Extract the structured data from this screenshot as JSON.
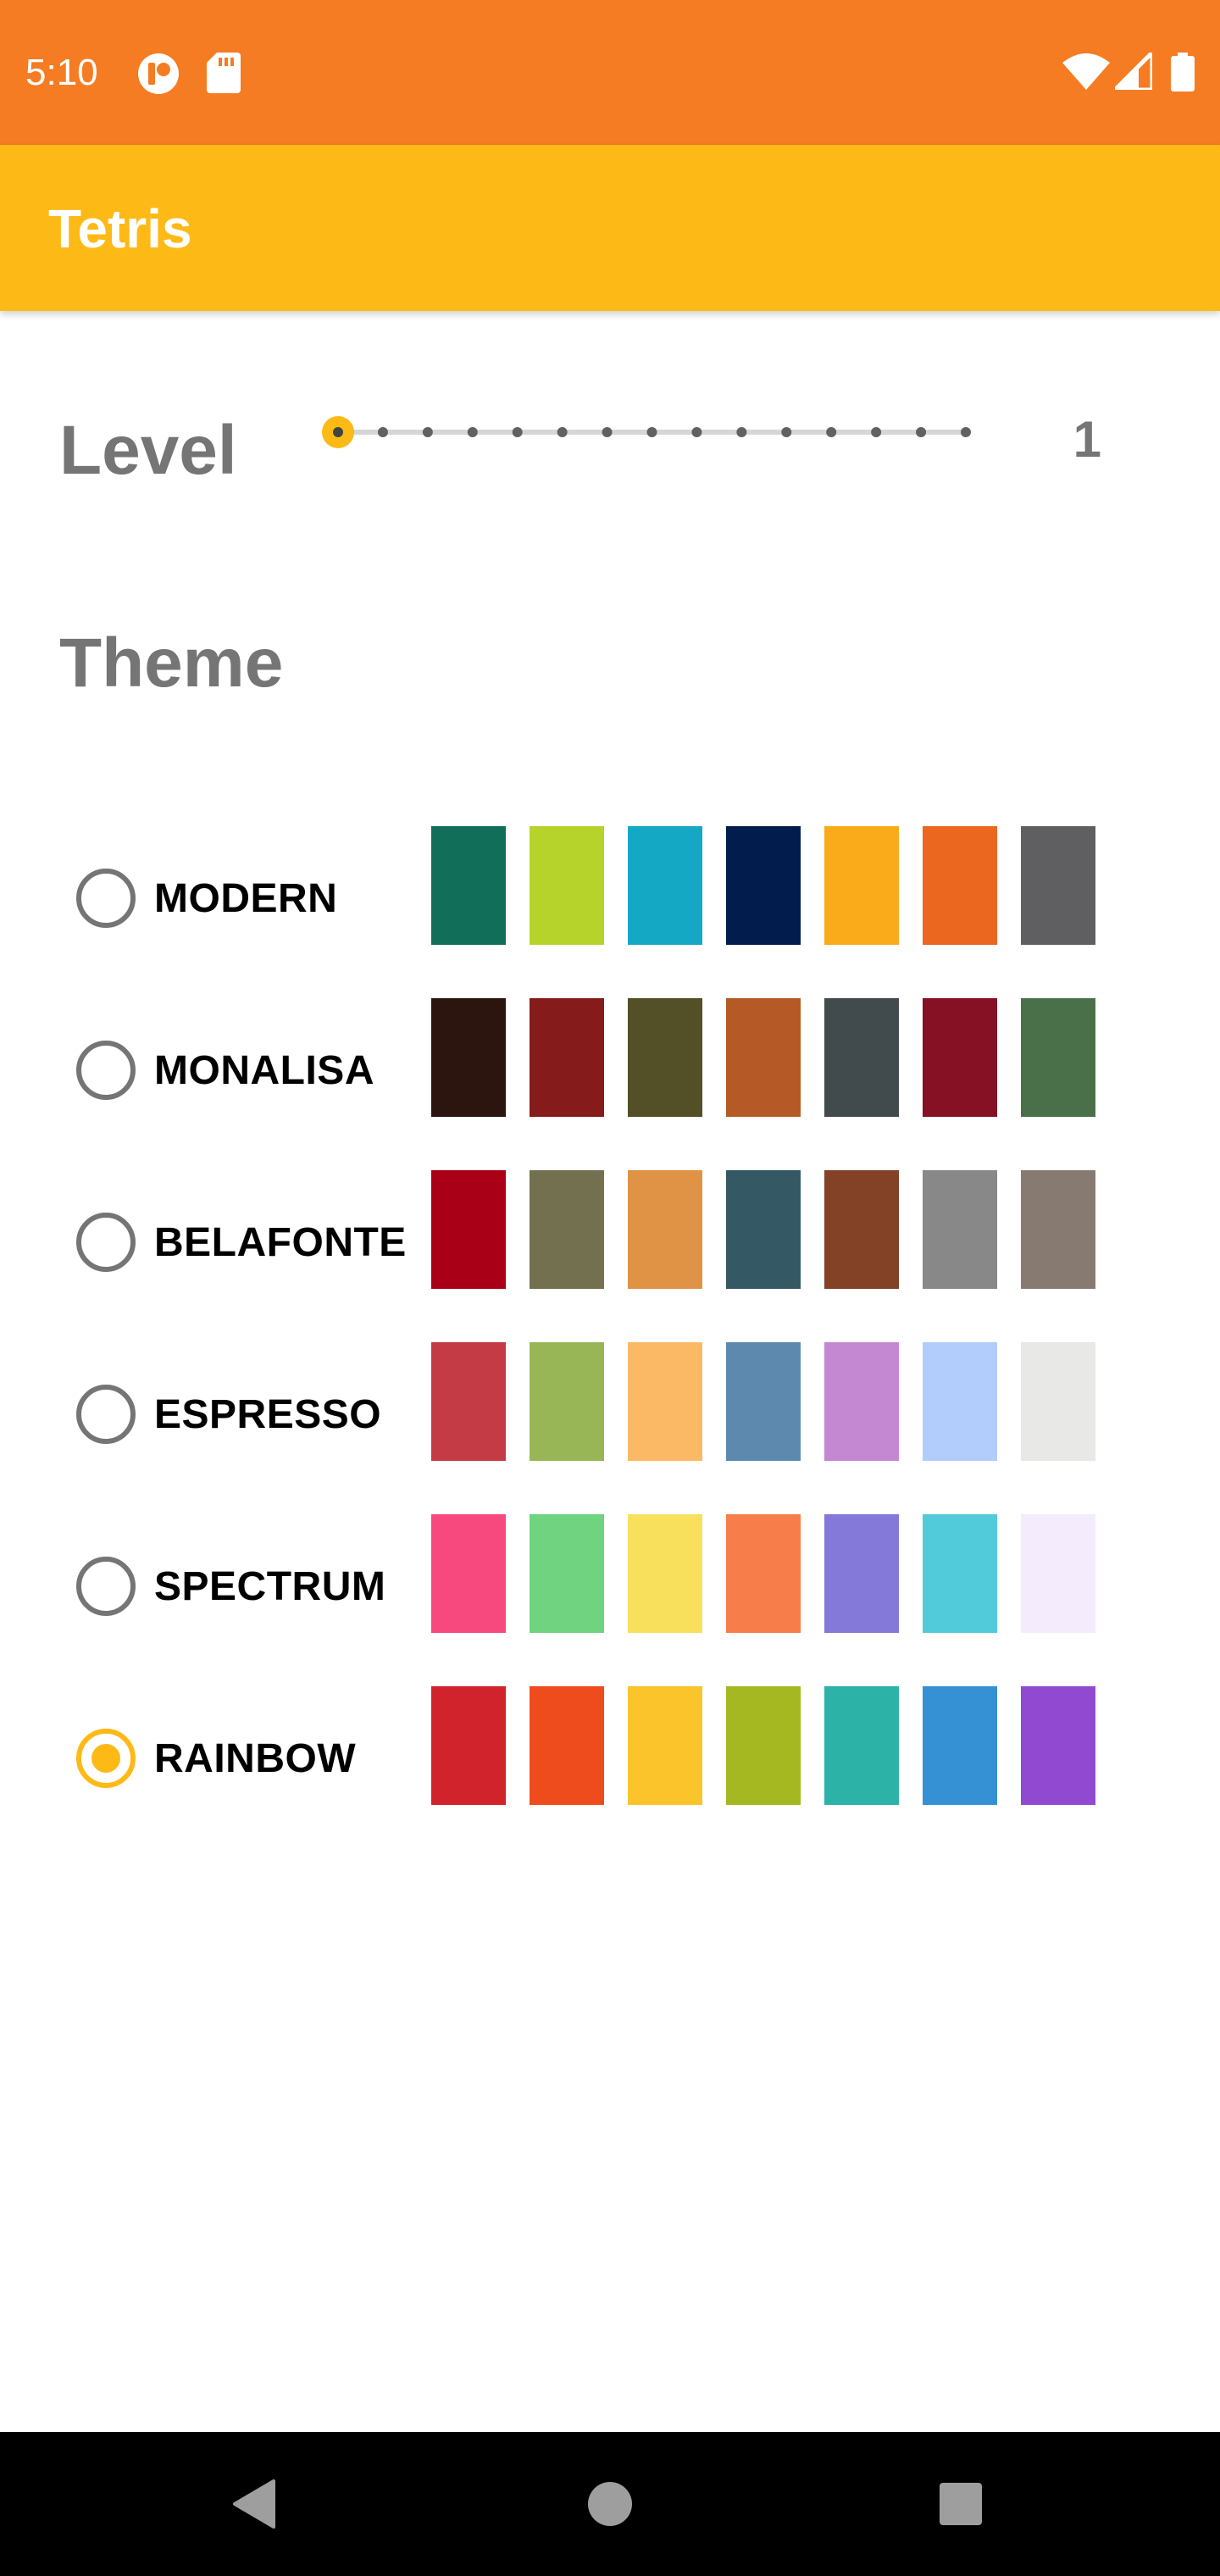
{
  "status_bar": {
    "time": "5:10",
    "color": "#F57C22",
    "icons": [
      "notification-app-icon",
      "sd-card-icon",
      "wifi-icon",
      "signal-icon",
      "battery-icon"
    ]
  },
  "app_bar": {
    "title": "Tetris",
    "color": "#FDB916"
  },
  "level": {
    "label": "Level",
    "value": "1",
    "min": 1,
    "max": 15,
    "current": 1
  },
  "theme": {
    "label": "Theme",
    "selected": "RAINBOW",
    "options": [
      {
        "name": "MODERN",
        "selected": false,
        "colors": [
          "#116E59",
          "#B5D32A",
          "#14A8C5",
          "#021D4D",
          "#FAAB1A",
          "#EB661E",
          "#5F5F62"
        ]
      },
      {
        "name": "MONALISA",
        "selected": false,
        "colors": [
          "#2C150E",
          "#861B1C",
          "#534F27",
          "#B55A26",
          "#414A4D",
          "#861125",
          "#497049"
        ]
      },
      {
        "name": "BELAFONTE",
        "selected": false,
        "colors": [
          "#AA0017",
          "#737050",
          "#E09345",
          "#345965",
          "#834125",
          "#888889",
          "#877B71"
        ]
      },
      {
        "name": "ESPRESSO",
        "selected": false,
        "colors": [
          "#C43B46",
          "#99B656",
          "#FCB965",
          "#5D89AF",
          "#C487D1",
          "#B2CCFC",
          "#E8E8E6"
        ]
      },
      {
        "name": "SPECTRUM",
        "selected": false,
        "colors": [
          "#F7497E",
          "#6FD37F",
          "#F8E05C",
          "#F77E4B",
          "#8478D9",
          "#51CBDA",
          "#F4EBFD"
        ]
      },
      {
        "name": "RAINBOW",
        "selected": true,
        "colors": [
          "#D1232B",
          "#EF4C1E",
          "#FBC42A",
          "#A5B822",
          "#2DB2A8",
          "#3691D4",
          "#9149D1"
        ]
      }
    ]
  },
  "nav_bar": {
    "buttons": [
      "back-icon",
      "home-icon",
      "recents-icon"
    ]
  }
}
